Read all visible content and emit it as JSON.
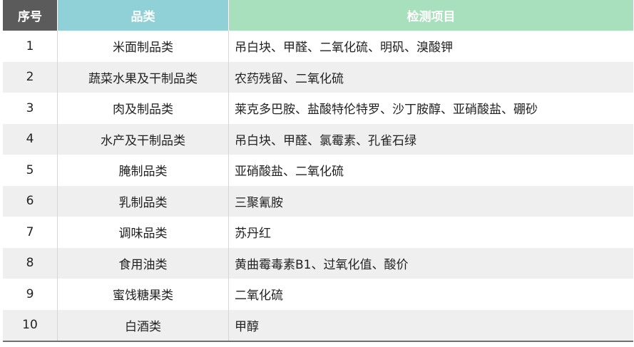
{
  "table": {
    "headers": {
      "no": "序号",
      "category": "品类",
      "items": "检测项目"
    },
    "rows": [
      {
        "no": "1",
        "category": "米面制品类",
        "items": "吊白块、甲醛、二氧化硫、明矾、溴酸钾"
      },
      {
        "no": "2",
        "category": "蔬菜水果及干制品类",
        "items": "农药残留、二氧化硫"
      },
      {
        "no": "3",
        "category": "肉及制品类",
        "items": "莱克多巴胺、盐酸特伦特罗、沙丁胺醇、亚硝酸盐、硼砂"
      },
      {
        "no": "4",
        "category": "水产及干制品类",
        "items": "吊白块、甲醛、氯霉素、孔雀石绿"
      },
      {
        "no": "5",
        "category": "腌制品类",
        "items": "亚硝酸盐、二氧化硫"
      },
      {
        "no": "6",
        "category": "乳制品类",
        "items": "三聚氰胺"
      },
      {
        "no": "7",
        "category": "调味品类",
        "items": "苏丹红"
      },
      {
        "no": "8",
        "category": "食用油类",
        "items": "黄曲霉毒素B1、过氧化值、酸价"
      },
      {
        "no": "9",
        "category": "蜜饯糖果类",
        "items": "二氧化硫"
      },
      {
        "no": "10",
        "category": "白酒类",
        "items": "甲醇"
      }
    ]
  }
}
